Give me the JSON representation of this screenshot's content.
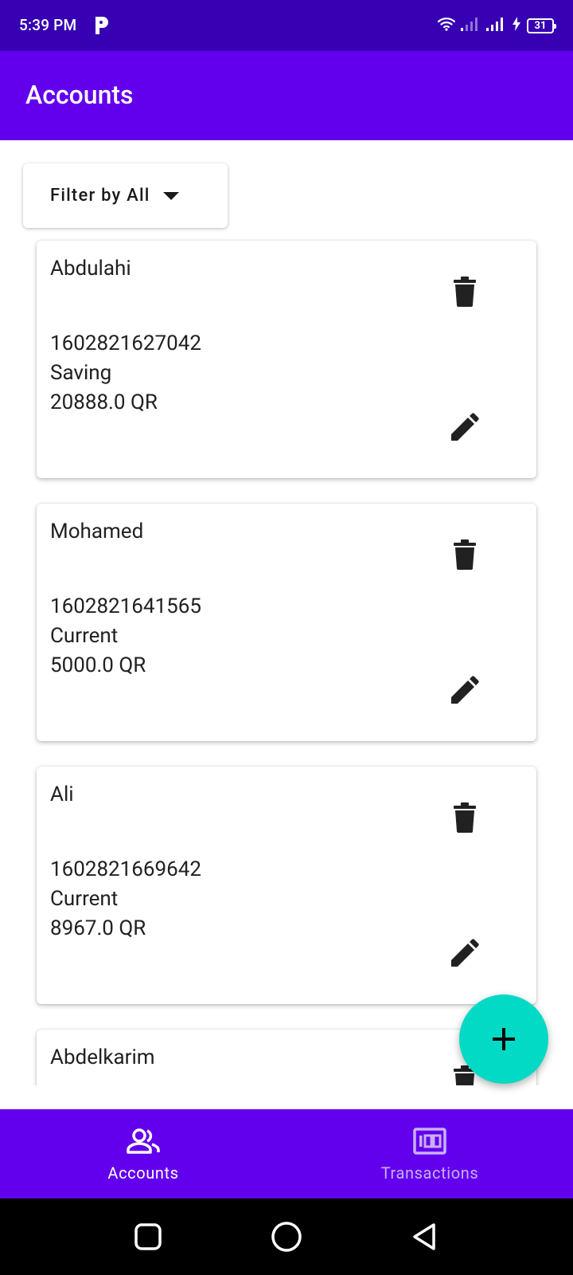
{
  "status_bar": {
    "time": "5:39 PM",
    "battery": "31"
  },
  "app_bar": {
    "title": "Accounts"
  },
  "filter": {
    "label": "Filter by All"
  },
  "accounts": [
    {
      "name": "Abdulahi",
      "number": "1602821627042",
      "type": "Saving",
      "balance": "20888.0 QR"
    },
    {
      "name": "Mohamed",
      "number": "1602821641565",
      "type": "Current",
      "balance": "5000.0 QR"
    },
    {
      "name": "Ali",
      "number": "1602821669642",
      "type": "Current",
      "balance": "8967.0 QR"
    },
    {
      "name": "Abdelkarim"
    }
  ],
  "bottom_nav": {
    "items": [
      {
        "label": "Accounts",
        "icon": "people-icon",
        "active": true
      },
      {
        "label": "Transactions",
        "icon": "counter-100-icon",
        "active": false
      }
    ]
  },
  "colors": {
    "status_bar": "#3700b3",
    "primary": "#6200ee",
    "fab": "#03dac5",
    "inactive_nav_label": "#c9b0f5"
  }
}
